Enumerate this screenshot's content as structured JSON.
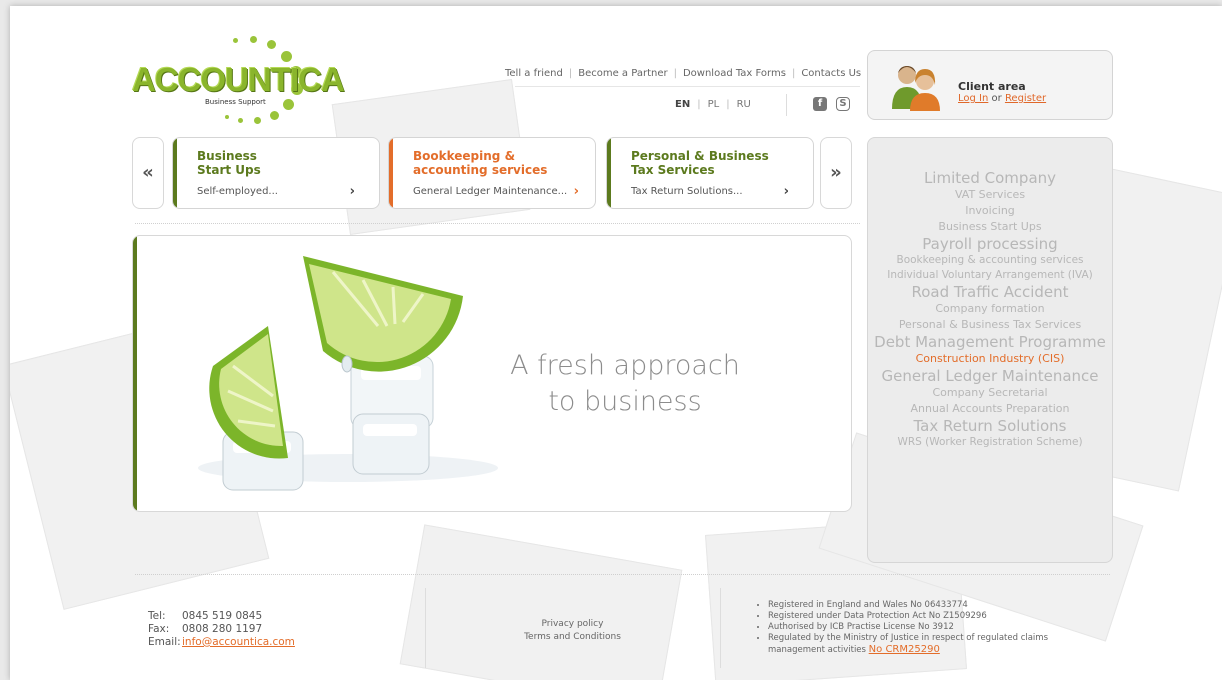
{
  "logo": {
    "name": "ACCOUNTICA",
    "tagline": "Business Support"
  },
  "top_nav": {
    "items": [
      "Tell a friend",
      "Become a Partner",
      "Download Tax Forms",
      "Contacts Us"
    ]
  },
  "languages": {
    "items": [
      "EN",
      "PL",
      "RU"
    ],
    "active": "EN"
  },
  "social": {
    "icons": [
      "facebook-icon",
      "skype-icon"
    ],
    "facebook_glyph": "f",
    "skype_glyph": "S"
  },
  "client_area": {
    "title": "Client area",
    "login": "Log In",
    "or": "or",
    "register": "Register"
  },
  "carousel": {
    "prev": "«",
    "next": "»"
  },
  "tabs": [
    {
      "title": "Business\nStart Ups",
      "subtitle": "Self-employed...",
      "color": "#5c7a1e"
    },
    {
      "title": "Bookkeeping &\naccounting services",
      "subtitle": "General Ledger Maintenance...",
      "color": "#e36d2a"
    },
    {
      "title": "Personal & Business\nTax Services",
      "subtitle": "Tax Return Solutions...",
      "color": "#5c7a1e"
    }
  ],
  "hero": {
    "line1": "A fresh approach",
    "line2": "to business"
  },
  "services_menu": [
    {
      "label": "Limited Company",
      "size": "s1"
    },
    {
      "label": "VAT Services",
      "size": "s2"
    },
    {
      "label": "Invoicing",
      "size": "s2"
    },
    {
      "label": "Business Start Ups",
      "size": "s2"
    },
    {
      "label": "Payroll processing",
      "size": "s1"
    },
    {
      "label": "Bookkeeping & accounting services",
      "size": "s3"
    },
    {
      "label": "Individual Voluntary Arrangement (IVA)",
      "size": "s3"
    },
    {
      "label": "Road Traffic Accident",
      "size": "s1"
    },
    {
      "label": "Company formation",
      "size": "s2"
    },
    {
      "label": "Personal & Business Tax Services",
      "size": "s2"
    },
    {
      "label": "Debt Management Programme",
      "size": "s1"
    },
    {
      "label": "Construction Industry (CIS)",
      "size": "s2",
      "highlight": true
    },
    {
      "label": "General Ledger Maintenance",
      "size": "s1"
    },
    {
      "label": "Company Secretarial",
      "size": "s2"
    },
    {
      "label": "Annual Accounts Preparation",
      "size": "s2"
    },
    {
      "label": "Tax Return Solutions",
      "size": "s1"
    },
    {
      "label": "WRS (Worker Registration Scheme)",
      "size": "s3"
    }
  ],
  "footer": {
    "tel_label": "Tel:",
    "tel": "0845 519 0845",
    "fax_label": "Fax:",
    "fax": "0808 280 1197",
    "email_label": "Email:",
    "email": "info@accountica.com",
    "privacy": "Privacy policy",
    "terms": "Terms and Conditions",
    "registration": [
      "Registered in England and Wales No 06433774",
      "Registered under Data Protection Act No Z1509296",
      "Authorised by ICB Practise License No 3912",
      "Regulated by the Ministry of Justice in respect of regulated claims management activities"
    ],
    "crm_link": "No CRM25290"
  },
  "colors": {
    "brand_green": "#8ab52c",
    "dark_green": "#5c7a1e",
    "accent_orange": "#e36d2a"
  }
}
